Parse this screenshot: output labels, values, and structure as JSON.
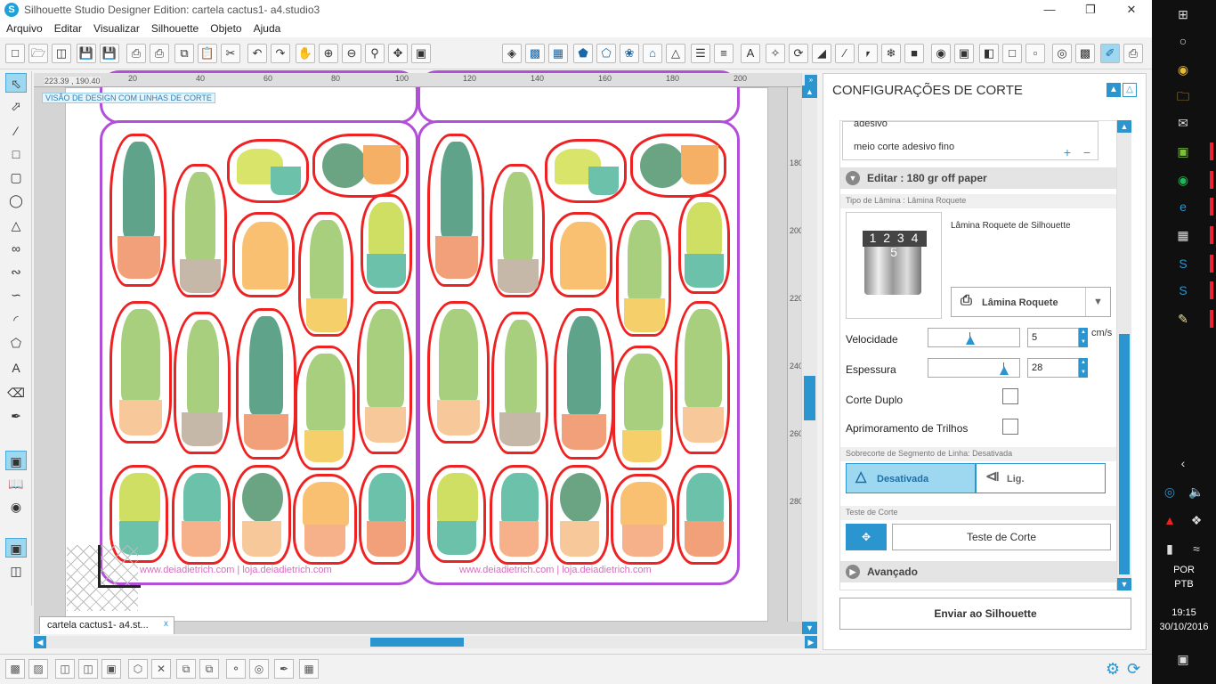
{
  "window": {
    "title": "Silhouette Studio Designer Edition: cartela cactus1- a4.studio3",
    "minimize": "—",
    "maximize": "❐",
    "close": "✕"
  },
  "menu": [
    "Arquivo",
    "Editar",
    "Visualizar",
    "Silhouette",
    "Objeto",
    "Ajuda"
  ],
  "canvas": {
    "coord_readout": "223.39 , 190.40",
    "mode_label": "VISÃO DE DESIGN COM LINHAS DE CORTE",
    "ruler_top": [
      "20",
      "40",
      "60",
      "80",
      "100",
      "120",
      "140",
      "160",
      "180",
      "200"
    ],
    "ruler_right": [
      "180",
      "200",
      "220",
      "240",
      "260",
      "280"
    ],
    "footer_left": "www.deiadietrich.com | loja.deiadietrich.com",
    "footer_right": "www.deiadietrich.com | loja.deiadietrich.com"
  },
  "doc_tab": {
    "label": "cartela cactus1- a4.st...",
    "close": "x"
  },
  "panel": {
    "title": "CONFIGURAÇÕES DE CORTE",
    "material_items": [
      "adesivo",
      "meio corte adesivo fino"
    ],
    "material_add": "+",
    "material_remove": "−",
    "edit_section": "Editar : 180 gr off paper",
    "blade_type_header": "Tipo de Lâmina : Lâmina Roquete",
    "blade_numbers": "1 2 3 4 5",
    "blade_name": "Lâmina Roquete de Silhouette",
    "blade_select": "Lâmina Roquete",
    "speed_label": "Velocidade",
    "speed_value": "5",
    "speed_unit": "cm/s",
    "thickness_label": "Espessura",
    "thickness_value": "28",
    "double_cut_label": "Corte Duplo",
    "track_label": "Aprimoramento de Trilhos",
    "overcut_header": "Sobrecorte de Segmento de Linha: Desativada",
    "overcut_off": "Desativada",
    "overcut_on": "Lig.",
    "test_header": "Teste de Corte",
    "test_button": "Teste de Corte",
    "advanced": "Avançado",
    "send_button": "Enviar ao Silhouette"
  },
  "taskbar": {
    "lang1": "POR",
    "lang2": "PTB",
    "time": "19:15",
    "date": "30/10/2016"
  },
  "colors": {
    "accent": "#2b95cf",
    "cut_line": "#e22222",
    "sheet_border": "#b24fd8"
  }
}
